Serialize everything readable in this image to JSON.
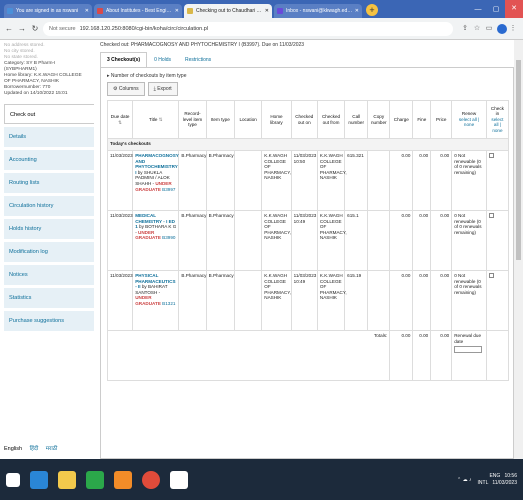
{
  "browser": {
    "tabs": [
      {
        "label": "You are signed in as nswani",
        "color": "#4a90d9"
      },
      {
        "label": "About Institutes - Best Engineeri",
        "color": "#d94a4a"
      },
      {
        "label": "Checking out to Chaudhari Ashv",
        "color": "#d9b84a"
      },
      {
        "label": "Inbox - nswani@kkwagh.edu.in",
        "color": "#6a4ad9"
      }
    ],
    "address": "192.168.120.250:8080/cgi-bin/koha/circ/circulation.pl",
    "not_secure": "Not secure"
  },
  "patron": {
    "lines_grey": [
      "No address stored.",
      "No city stored.",
      "No state stored."
    ],
    "lines": [
      "Category: SY B Pharm-I",
      "(SYBPHARM1)",
      "Home library: K.K.WAGH COLLEGE",
      "OF PHARMACY, NASHIK",
      "Borrowernumber: 770",
      "Updated on 14/10/2022 15:01"
    ]
  },
  "sidebar": {
    "items": [
      {
        "label": "Check out"
      },
      {
        "label": "Details"
      },
      {
        "label": "Accounting"
      },
      {
        "label": "Routing lists"
      },
      {
        "label": "Circulation history"
      },
      {
        "label": "Holds history"
      },
      {
        "label": "Modification log"
      },
      {
        "label": "Notices"
      },
      {
        "label": "Statistics"
      },
      {
        "label": "Purchase suggestions"
      }
    ],
    "languages": [
      "English",
      "हिंदी",
      "मराठी"
    ]
  },
  "main": {
    "notice": "Checked out: PHARMACOGNOSY AND PHYTOCHEMISTRY I (B3997). Due on 11/03/2023",
    "tabs": [
      "3 Checkout(s)",
      "0 Holds",
      "Restrictions"
    ],
    "types_toggle": "▸ Number of checkouts by item type",
    "columns_btn": "Columns",
    "export_btn": "Export",
    "headers": {
      "due": "Due date",
      "title": "Title",
      "record_type": "Record-level item type",
      "item_type": "Item type",
      "location": "Location",
      "home": "Home library",
      "checked_on": "Checked out on",
      "checked_from": "Checked out from",
      "call": "Call number",
      "copy": "Copy number",
      "charge": "Charge",
      "fine": "Fine",
      "price": "Price",
      "renew": "Renew",
      "renew_link": "select all | none",
      "checkin": "Check in",
      "checkin_link": "select all | none"
    },
    "section_label": "Today's checkouts",
    "rows": [
      {
        "due": "11/03/2023",
        "title": "PHARMACOGNOSY AND PHYTOCHEMISTRY I",
        "author": "by SHUKLA PADMINI / ALOK SHAHH -",
        "tag": "UNDER GRADUATE",
        "barcode": "B3997",
        "record_type": "B.Pharmacy",
        "item_type": "B.Pharmacy",
        "home": "K.K.WAGH COLLEGE OF PHARMACY, NASHIK",
        "checked_on": "11/03/2023 10:50",
        "checked_from": "K.K.WAGH COLLEGE OF PHARMACY, NASHIK",
        "call": "615.321",
        "charge": "0.00",
        "fine": "0.00",
        "price": "0.00",
        "renew": "0 Not renewable (0 of 0 renewals remaining)"
      },
      {
        "due": "11/03/2023",
        "title": "MEDICAL CHEMISTRY - I ED 1",
        "author": "by BOTHARA K G -",
        "tag": "UNDER GRADUATE",
        "barcode": "B3990",
        "record_type": "B.Pharmacy",
        "item_type": "B.Pharmacy",
        "home": "K.K.WAGH COLLEGE OF PHARMACY, NASHIK",
        "checked_on": "11/03/2023 10:49",
        "checked_from": "K.K.WAGH COLLEGE OF PHARMACY, NASHIK",
        "call": "615.1",
        "charge": "0.00",
        "fine": "0.00",
        "price": "0.00",
        "renew": "0 Not renewable (0 of 0 renewals remaining)"
      },
      {
        "due": "11/03/2023",
        "title": "PHYSICAL PHARMACEUTICS - II",
        "author": "by BAHIRAT SANTOSH -",
        "tag": "UNDER GRADUATE",
        "barcode": "B1321",
        "record_type": "B.Pharmacy",
        "item_type": "B.Pharmacy",
        "home": "K.K.WAGH COLLEGE OF PHARMACY, NASHIK",
        "checked_on": "11/03/2023 10:49",
        "checked_from": "K.K.WAGH COLLEGE OF PHARMACY, NASHIK",
        "call": "615.19",
        "charge": "0.00",
        "fine": "0.00",
        "price": "0.00",
        "renew": "0 Not renewable (0 of 0 renewals remaining)"
      }
    ],
    "totals_label": "Totals:",
    "totals": {
      "charge": "0.00",
      "fine": "0.00",
      "price": "0.00"
    },
    "renewal_due": "Renewal due date"
  },
  "taskbar": {
    "lang": "ENG",
    "region": "INTL",
    "time": "10:56",
    "date": "11/03/2023",
    "colors": {
      "bg": "#1c2a3b"
    }
  }
}
